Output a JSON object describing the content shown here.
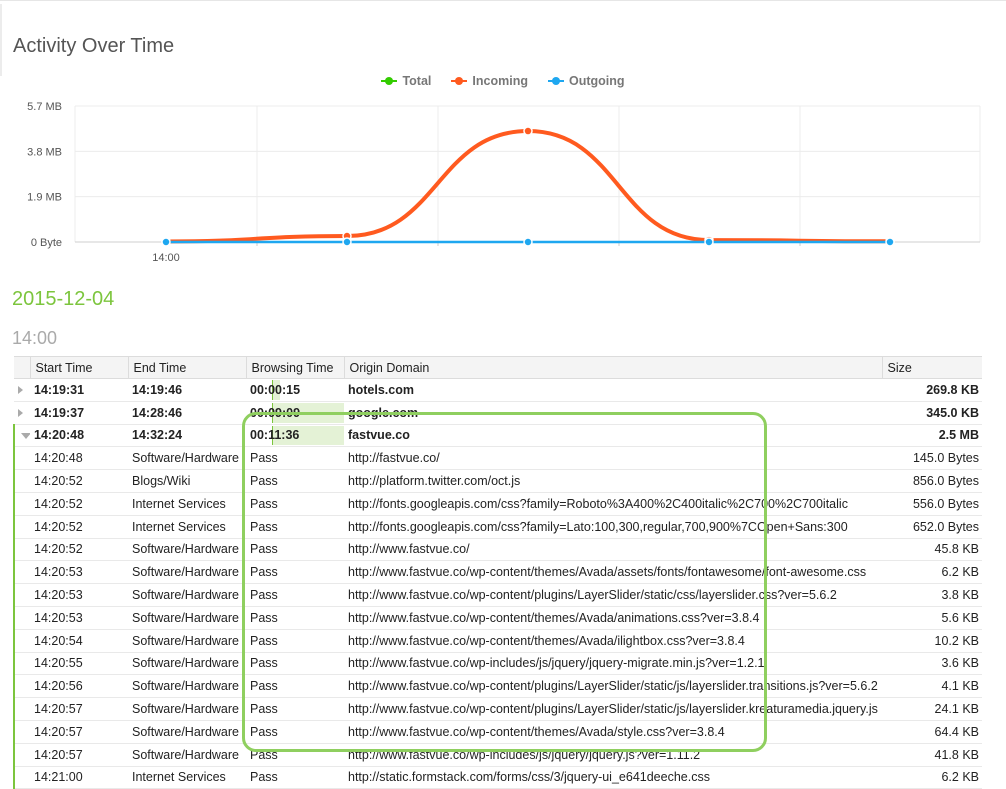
{
  "page": {
    "title": "Activity Over Time"
  },
  "legend": [
    {
      "label": "Total",
      "color": "#33cc00"
    },
    {
      "label": "Incoming",
      "color": "#ff5a1f"
    },
    {
      "label": "Outgoing",
      "color": "#1ea7f0"
    }
  ],
  "chart_data": {
    "type": "line",
    "y_ticks": [
      "5.7 MB",
      "3.8 MB",
      "1.9 MB",
      "0 Byte"
    ],
    "y_range_mb": [
      0,
      5.7
    ],
    "x_ticks": [
      "14:00"
    ],
    "grid": true,
    "series": [
      {
        "name": "Total",
        "color": "#33cc00",
        "values_mb": [
          0.02,
          0.25,
          4.65,
          0.08,
          0.03
        ]
      },
      {
        "name": "Incoming",
        "color": "#ff5a1f",
        "values_mb": [
          0.02,
          0.25,
          4.65,
          0.08,
          0.03
        ]
      },
      {
        "name": "Outgoing",
        "color": "#1ea7f0",
        "values_mb": [
          0.0,
          0.0,
          0.0,
          0.0,
          0.0
        ]
      }
    ]
  },
  "date_heading": "2015-12-04",
  "hour_heading": "14:00",
  "table": {
    "columns": [
      "Start Time",
      "End Time",
      "Browsing Time",
      "Origin Domain",
      "Size"
    ],
    "sessions": [
      {
        "start": "14:19:31",
        "end": "14:19:46",
        "browse": "00:00:15",
        "domain": "hotels.com",
        "size": "269.8 KB",
        "bar_fraction": 0.04,
        "expanded": false
      },
      {
        "start": "14:19:37",
        "end": "14:28:46",
        "browse": "00:09:09",
        "domain": "google.com",
        "size": "345.0 KB",
        "bar_fraction": 0.5,
        "expanded": false
      },
      {
        "start": "14:20:48",
        "end": "14:32:24",
        "browse": "00:11:36",
        "domain": "fastvue.co",
        "size": "2.5 MB",
        "bar_fraction": 1.0,
        "expanded": true
      }
    ],
    "details": [
      {
        "time": "14:20:48",
        "category": "Software/Hardware",
        "status": "Pass",
        "url": "http://fastvue.co/",
        "size": "145.0 Bytes"
      },
      {
        "time": "14:20:52",
        "category": "Blogs/Wiki",
        "status": "Pass",
        "url": "http://platform.twitter.com/oct.js",
        "size": "856.0 Bytes"
      },
      {
        "time": "14:20:52",
        "category": "Internet Services",
        "status": "Pass",
        "url": "http://fonts.googleapis.com/css?family=Roboto%3A400%2C400italic%2C700%2C700italic",
        "size": "556.0 Bytes"
      },
      {
        "time": "14:20:52",
        "category": "Internet Services",
        "status": "Pass",
        "url": "http://fonts.googleapis.com/css?family=Lato:100,300,regular,700,900%7COpen+Sans:300",
        "size": "652.0 Bytes"
      },
      {
        "time": "14:20:52",
        "category": "Software/Hardware",
        "status": "Pass",
        "url": "http://www.fastvue.co/",
        "size": "45.8 KB"
      },
      {
        "time": "14:20:53",
        "category": "Software/Hardware",
        "status": "Pass",
        "url": "http://www.fastvue.co/wp-content/themes/Avada/assets/fonts/fontawesome/font-awesome.css",
        "size": "6.2 KB"
      },
      {
        "time": "14:20:53",
        "category": "Software/Hardware",
        "status": "Pass",
        "url": "http://www.fastvue.co/wp-content/plugins/LayerSlider/static/css/layerslider.css?ver=5.6.2",
        "size": "3.8 KB"
      },
      {
        "time": "14:20:53",
        "category": "Software/Hardware",
        "status": "Pass",
        "url": "http://www.fastvue.co/wp-content/themes/Avada/animations.css?ver=3.8.4",
        "size": "5.6 KB"
      },
      {
        "time": "14:20:54",
        "category": "Software/Hardware",
        "status": "Pass",
        "url": "http://www.fastvue.co/wp-content/themes/Avada/ilightbox.css?ver=3.8.4",
        "size": "10.2 KB"
      },
      {
        "time": "14:20:55",
        "category": "Software/Hardware",
        "status": "Pass",
        "url": "http://www.fastvue.co/wp-includes/js/jquery/jquery-migrate.min.js?ver=1.2.1",
        "size": "3.6 KB"
      },
      {
        "time": "14:20:56",
        "category": "Software/Hardware",
        "status": "Pass",
        "url": "http://www.fastvue.co/wp-content/plugins/LayerSlider/static/js/layerslider.transitions.js?ver=5.6.2",
        "size": "4.1 KB"
      },
      {
        "time": "14:20:57",
        "category": "Software/Hardware",
        "status": "Pass",
        "url": "http://www.fastvue.co/wp-content/plugins/LayerSlider/static/js/layerslider.kreaturamedia.jquery.js",
        "size": "24.1 KB"
      },
      {
        "time": "14:20:57",
        "category": "Software/Hardware",
        "status": "Pass",
        "url": "http://www.fastvue.co/wp-content/themes/Avada/style.css?ver=3.8.4",
        "size": "64.4 KB"
      },
      {
        "time": "14:20:57",
        "category": "Software/Hardware",
        "status": "Pass",
        "url": "http://www.fastvue.co/wp-includes/js/jquery/jquery.js?ver=1.11.2",
        "size": "41.8 KB"
      },
      {
        "time": "14:21:00",
        "category": "Internet Services",
        "status": "Pass",
        "url": "http://static.formstack.com/forms/css/3/jquery-ui_e641deeche.css",
        "size": "6.2 KB"
      }
    ]
  }
}
